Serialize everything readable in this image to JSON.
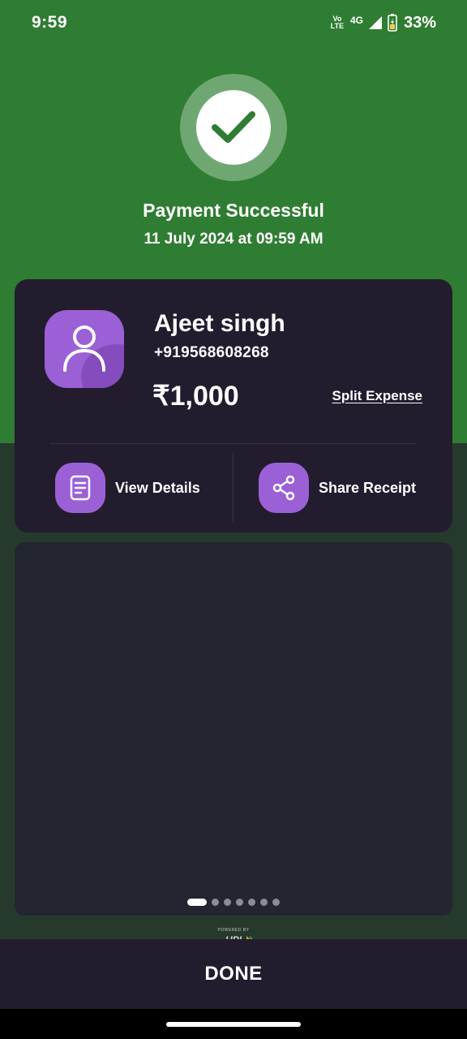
{
  "status_bar": {
    "time": "9:59",
    "volte_line1": "Vo",
    "volte_line2": "LTE",
    "network": "4G",
    "battery": "33%"
  },
  "header": {
    "title": "Payment Successful",
    "datetime": "11 July 2024 at 09:59 AM"
  },
  "card": {
    "name": "Ajeet singh",
    "phone": "+919568608268",
    "amount": "₹1,000",
    "split_label": "Split Expense",
    "view_details_label": "View Details",
    "share_receipt_label": "Share Receipt"
  },
  "carousel": {
    "page_count": 7,
    "active_index": 0
  },
  "footer": {
    "powered_by": "POWERED BY",
    "brand": "UPI",
    "done_label": "DONE"
  },
  "colors": {
    "success_green": "#2f7d32",
    "card_bg": "#231c2e",
    "accent_purple": "#9b60d6"
  }
}
